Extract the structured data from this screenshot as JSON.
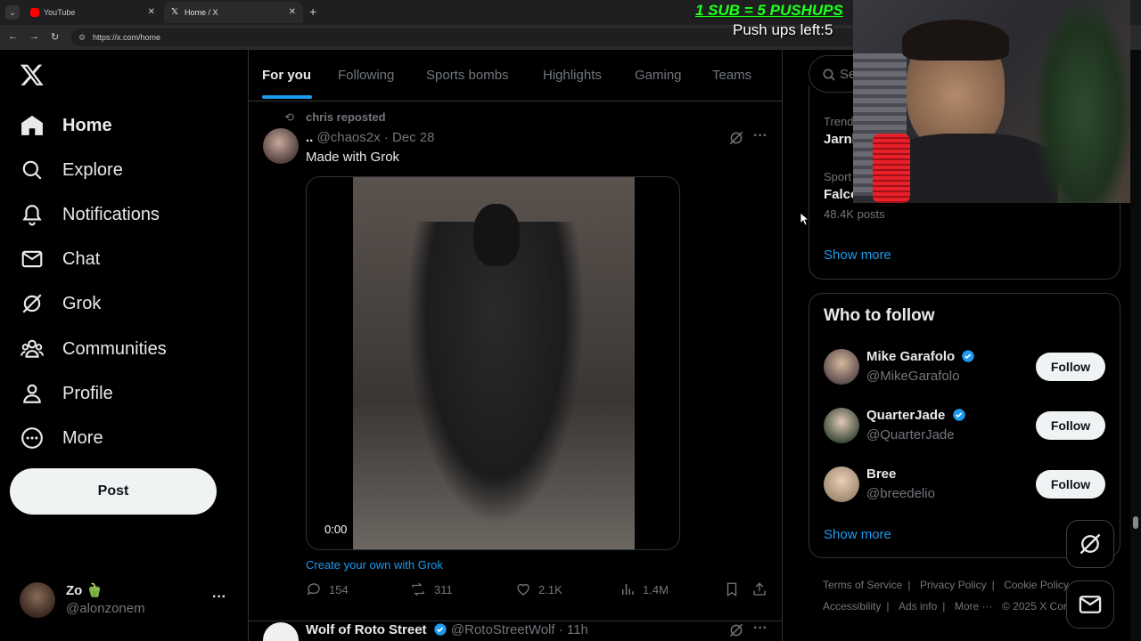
{
  "browser": {
    "tabs": [
      {
        "label": "YouTube",
        "active": false
      },
      {
        "label": "Home / X",
        "active": true
      }
    ],
    "url": "https://x.com/home",
    "new_tab_glyph": "+"
  },
  "stream_overlay": {
    "headline": "1 SUB = 5 PUSHUPS",
    "counter": "Push ups left:5"
  },
  "nav": {
    "logo": "X",
    "items": [
      {
        "label": "Home",
        "icon": "home-icon"
      },
      {
        "label": "Explore",
        "icon": "search-icon"
      },
      {
        "label": "Notifications",
        "icon": "bell-icon"
      },
      {
        "label": "Chat",
        "icon": "mail-icon"
      },
      {
        "label": "Grok",
        "icon": "grok-icon"
      },
      {
        "label": "Communities",
        "icon": "communities-icon"
      },
      {
        "label": "Profile",
        "icon": "person-icon"
      },
      {
        "label": "More",
        "icon": "more-circle-icon"
      }
    ],
    "post_label": "Post",
    "account": {
      "name": "Zo 🫑",
      "handle": "@alonzonem",
      "menu": "···"
    }
  },
  "feed": {
    "tabs": [
      "For you",
      "Following",
      "Sports bombs",
      "Highlights",
      "Gaming",
      "Teams"
    ],
    "active_tab": "For you",
    "post": {
      "repost_by": "chris reposted",
      "author_name": "..",
      "handle": "@chaos2x",
      "dot": "·",
      "date": "Dec 28",
      "text": "Made with Grok",
      "video_time": "0:00",
      "grok_link": "Create your own with Grok",
      "replies": "154",
      "reposts": "311",
      "likes": "2.1K",
      "views": "1.4M"
    },
    "next_post": {
      "author_name": "Wolf of Roto Street",
      "handle": "@RotoStreetWolf",
      "dot": "·",
      "time": "11h"
    }
  },
  "sidebar": {
    "search_placeholder": "Se",
    "trends": [
      {
        "category": "Trend",
        "name": "Jarnl",
        "posts": ""
      },
      {
        "category": "Sport",
        "name": "Falco",
        "posts": "48.4K posts"
      }
    ],
    "trends_show_more": "Show more",
    "who_to_follow": {
      "title": "Who to follow",
      "people": [
        {
          "name": "Mike Garafolo",
          "handle": "@MikeGarafolo",
          "verified": true,
          "button": "Follow"
        },
        {
          "name": "QuarterJade",
          "handle": "@QuarterJade",
          "verified": true,
          "button": "Follow"
        },
        {
          "name": "Bree",
          "handle": "@breedelio",
          "verified": false,
          "button": "Follow"
        }
      ],
      "show_more": "Show more"
    },
    "footer": {
      "row1": [
        "Terms of Service",
        "Privacy Policy",
        "Cookie Policy"
      ],
      "row2": [
        "Accessibility",
        "Ads info",
        "More ···",
        "© 2025 X Cor"
      ]
    }
  },
  "colors": {
    "accent": "#1d9bf0",
    "overlay_green": "#22ff22"
  }
}
